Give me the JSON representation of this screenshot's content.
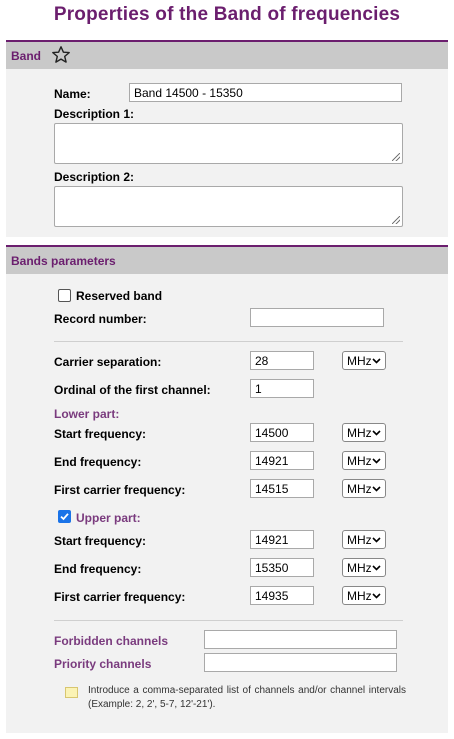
{
  "page_title": "Properties of the Band of frequencies",
  "band_section": {
    "title": "Band",
    "name_label": "Name:",
    "name_value": "Band 14500 - 15350",
    "desc1_label": "Description 1:",
    "desc1_value": "",
    "desc2_label": "Description 2:",
    "desc2_value": ""
  },
  "params_section": {
    "title": "Bands parameters",
    "reserved_label": "Reserved band",
    "reserved_checked": false,
    "record_label": "Record number:",
    "record_value": "",
    "carrier_sep_label": "Carrier separation:",
    "carrier_sep_value": "28",
    "carrier_sep_unit": "MHz",
    "ordinal_label": "Ordinal of the first channel:",
    "ordinal_value": "1",
    "lower": {
      "title": "Lower part:",
      "start_label": "Start frequency:",
      "start_value": "14500",
      "start_unit": "MHz",
      "end_label": "End frequency:",
      "end_value": "14921",
      "end_unit": "MHz",
      "first_label": "First carrier frequency:",
      "first_value": "14515",
      "first_unit": "MHz"
    },
    "upper": {
      "title": "Upper part:",
      "checked": true,
      "start_label": "Start frequency:",
      "start_value": "14921",
      "start_unit": "MHz",
      "end_label": "End frequency:",
      "end_value": "15350",
      "end_unit": "MHz",
      "first_label": "First carrier frequency:",
      "first_value": "14935",
      "first_unit": "MHz"
    },
    "forbidden_label": "Forbidden channels",
    "forbidden_value": "",
    "priority_label": "Priority channels",
    "priority_value": "",
    "note": "Introduce a comma-separated list of channels and/or channel intervals (Example: 2, 2', 5-7, 12'-21')."
  },
  "colors": {
    "accent": "#6b1e6e",
    "section_header": "#c9c9c9",
    "panel": "#f2f2f2",
    "checkbox_on": "#1a73e8"
  },
  "icons": {
    "favorite": "star-icon",
    "dropdown": "chevron-down-icon",
    "note": "note-icon"
  }
}
